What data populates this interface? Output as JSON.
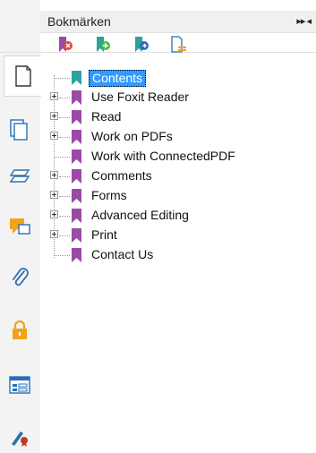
{
  "panel": {
    "title": "Bokmärken",
    "header_arrows": "▸▸ ◂"
  },
  "toolbar": {
    "buttons": [
      {
        "name": "delete-bookmark-icon"
      },
      {
        "name": "add-bookmark-icon"
      },
      {
        "name": "add-child-bookmark-icon"
      },
      {
        "name": "bookmark-options-icon"
      }
    ]
  },
  "rail": {
    "icons": [
      "page-icon",
      "pages-thumbnail-icon",
      "layers-icon",
      "comments-icon",
      "attachment-icon",
      "security-lock-icon",
      "form-fields-icon",
      "signature-icon"
    ]
  },
  "tree": {
    "items": [
      {
        "label": "Contents",
        "expandable": false,
        "selected": true,
        "color": "#2ba39a"
      },
      {
        "label": "Use Foxit Reader",
        "expandable": true,
        "selected": false,
        "color": "#9b4aa6"
      },
      {
        "label": "Read",
        "expandable": true,
        "selected": false,
        "color": "#9b4aa6"
      },
      {
        "label": "Work on PDFs",
        "expandable": true,
        "selected": false,
        "color": "#9b4aa6"
      },
      {
        "label": "Work with ConnectedPDF",
        "expandable": false,
        "selected": false,
        "color": "#9b4aa6"
      },
      {
        "label": "Comments",
        "expandable": true,
        "selected": false,
        "color": "#9b4aa6"
      },
      {
        "label": "Forms",
        "expandable": true,
        "selected": false,
        "color": "#9b4aa6"
      },
      {
        "label": "Advanced Editing",
        "expandable": true,
        "selected": false,
        "color": "#9b4aa6"
      },
      {
        "label": "Print",
        "expandable": true,
        "selected": false,
        "color": "#9b4aa6"
      },
      {
        "label": "Contact Us",
        "expandable": false,
        "selected": false,
        "color": "#9b4aa6"
      }
    ]
  },
  "colors": {
    "accent": "#3399ff",
    "bookmark_purple": "#9b4aa6",
    "bookmark_teal": "#2ba39a",
    "rail_orange": "#f2a21c",
    "rail_blue": "#2a6fb5"
  }
}
